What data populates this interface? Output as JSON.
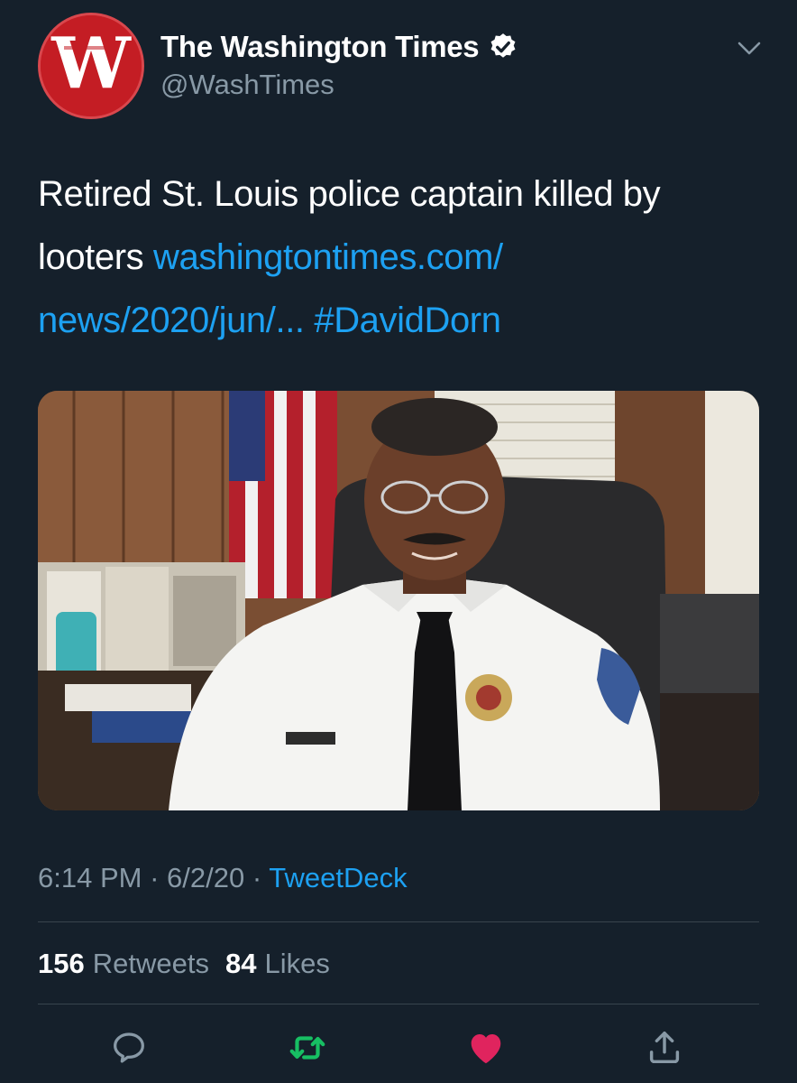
{
  "account": {
    "display_name": "The Washington Times",
    "handle": "@WashTimes",
    "avatar_letter": "W",
    "verified": true
  },
  "tweet": {
    "text_plain": "Retired St. Louis police captain killed by looters",
    "link_text_line1": "washingtontimes.com/",
    "link_text_line2": "news/2020/jun/...",
    "hashtag": "#DavidDorn"
  },
  "meta": {
    "time": "6:14 PM",
    "separator": "·",
    "date": "6/2/20",
    "source": "TweetDeck"
  },
  "stats": {
    "retweets_count": "156",
    "retweets_label": "Retweets",
    "likes_count": "84",
    "likes_label": "Likes"
  },
  "colors": {
    "background": "#15202b",
    "link": "#1da1f2",
    "secondary_text": "#8899a6",
    "divider": "#38444d",
    "retweet": "#17bf63",
    "like": "#e0245e",
    "avatar": "#c41d24"
  },
  "icons": {
    "reply": "reply-icon",
    "retweet": "retweet-icon",
    "like": "heart-icon",
    "share": "share-icon",
    "verified": "verified-badge-icon",
    "menu": "chevron-down-icon"
  }
}
